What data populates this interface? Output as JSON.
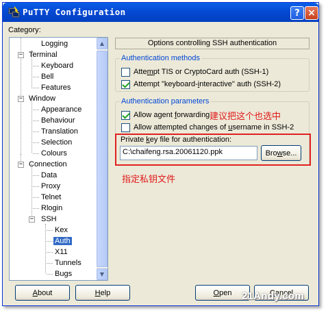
{
  "window": {
    "title": "PuTTY Configuration",
    "help_button": "?",
    "close_button": "×"
  },
  "category_label": "Category:",
  "tree": [
    {
      "label": "Logging",
      "level": 2
    },
    {
      "label": "Terminal",
      "level": 0,
      "expander": "−"
    },
    {
      "label": "Keyboard",
      "level": 1
    },
    {
      "label": "Bell",
      "level": 1
    },
    {
      "label": "Features",
      "level": 1
    },
    {
      "label": "Window",
      "level": 0,
      "expander": "−"
    },
    {
      "label": "Appearance",
      "level": 1
    },
    {
      "label": "Behaviour",
      "level": 1
    },
    {
      "label": "Translation",
      "level": 1
    },
    {
      "label": "Selection",
      "level": 1
    },
    {
      "label": "Colours",
      "level": 1
    },
    {
      "label": "Connection",
      "level": 0,
      "expander": "−"
    },
    {
      "label": "Data",
      "level": 1
    },
    {
      "label": "Proxy",
      "level": 1
    },
    {
      "label": "Telnet",
      "level": 1
    },
    {
      "label": "Rlogin",
      "level": 1
    },
    {
      "label": "SSH",
      "level": 1,
      "expander": "−"
    },
    {
      "label": "Kex",
      "level": 2
    },
    {
      "label": "Auth",
      "level": 2,
      "selected": true
    },
    {
      "label": "X11",
      "level": 2
    },
    {
      "label": "Tunnels",
      "level": 2
    },
    {
      "label": "Bugs",
      "level": 2
    }
  ],
  "panel_title": "Options controlling SSH authentication",
  "auth_methods": {
    "legend": "Authentication methods",
    "tis": {
      "pre": "Atte",
      "hot": "m",
      "post": "pt TIS or CryptoCard auth (SSH-1)",
      "checked": false
    },
    "kbdint": {
      "pre": "Attempt \"keyboard-",
      "hot": "i",
      "post": "nteractive\" auth (SSH-2)",
      "checked": true
    }
  },
  "auth_params": {
    "legend": "Authentication parameters",
    "agentfwd": {
      "pre": "Allow agent ",
      "hot": "f",
      "post": "orwarding",
      "checked": true
    },
    "change_user": {
      "pre": "Allow attempted changes of ",
      "hot": "u",
      "post": "sername in SSH-2",
      "checked": false
    },
    "keyfile_label": {
      "pre": "Private ",
      "hot": "k",
      "post": "ey file for authentication:"
    },
    "keyfile_value": "C:\\chaifeng.rsa.20061120.ppk",
    "browse": {
      "pre": "Bro",
      "hot": "w",
      "post": "se..."
    }
  },
  "annotations": {
    "suggest_check": "建议把这个也选中",
    "specify_key": "指定私钥文件"
  },
  "buttons": {
    "about": {
      "hot": "A",
      "post": "bout"
    },
    "help": {
      "hot": "H",
      "post": "elp"
    },
    "open": {
      "hot": "O",
      "post": "pen"
    },
    "cancel": {
      "hot": "C",
      "post": "ancel"
    }
  },
  "watermark": "21Andy.com",
  "colors": {
    "title_bar": "#0549d4",
    "group_legend": "#0046d5",
    "annotation_red": "#e01a1a",
    "selection": "#316ac5"
  }
}
